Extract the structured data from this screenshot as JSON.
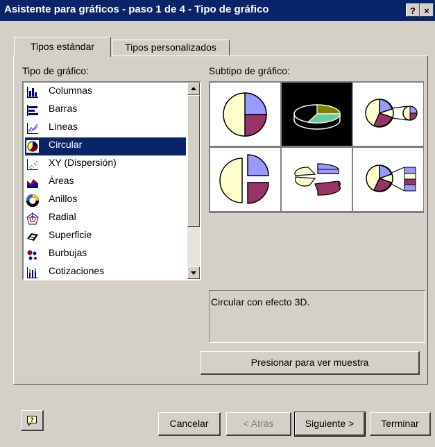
{
  "window": {
    "title": "Asistente para gráficos - paso 1 de 4 - Tipo de gráfico",
    "help_glyph": "?",
    "close_glyph": "×"
  },
  "tabs": [
    {
      "label": "Tipos estándar"
    },
    {
      "label": "Tipos personalizados"
    }
  ],
  "chart_type_label": "Tipo de gráfico:",
  "chart_subtype_label": "Subtipo de gráfico:",
  "chart_types": [
    {
      "label": "Columnas",
      "icon": "column-chart-icon"
    },
    {
      "label": "Barras",
      "icon": "bar-chart-icon"
    },
    {
      "label": "Líneas",
      "icon": "line-chart-icon"
    },
    {
      "label": "Circular",
      "icon": "pie-chart-icon",
      "selected": true
    },
    {
      "label": "XY (Dispersión)",
      "icon": "scatter-chart-icon"
    },
    {
      "label": "Áreas",
      "icon": "area-chart-icon"
    },
    {
      "label": "Anillos",
      "icon": "doughnut-chart-icon"
    },
    {
      "label": "Radial",
      "icon": "radar-chart-icon"
    },
    {
      "label": "Superficie",
      "icon": "surface-chart-icon"
    },
    {
      "label": "Burbujas",
      "icon": "bubble-chart-icon"
    },
    {
      "label": "Cotizaciones",
      "icon": "stock-chart-icon"
    }
  ],
  "selected_subtype_index": 1,
  "description": "Circular con efecto 3D.",
  "preview_button": "Presionar para ver muestra",
  "buttons": {
    "cancel": "Cancelar",
    "back": "< Atrás",
    "next": "Siguiente >",
    "finish": "Terminar"
  },
  "colors": {
    "titlebar": "#0a246a",
    "pie_yellow": "#ffffcc",
    "pie_purple": "#9999ff",
    "pie_maroon": "#993366",
    "pie_olive": "#808000",
    "pie_teal": "#66cc99"
  }
}
